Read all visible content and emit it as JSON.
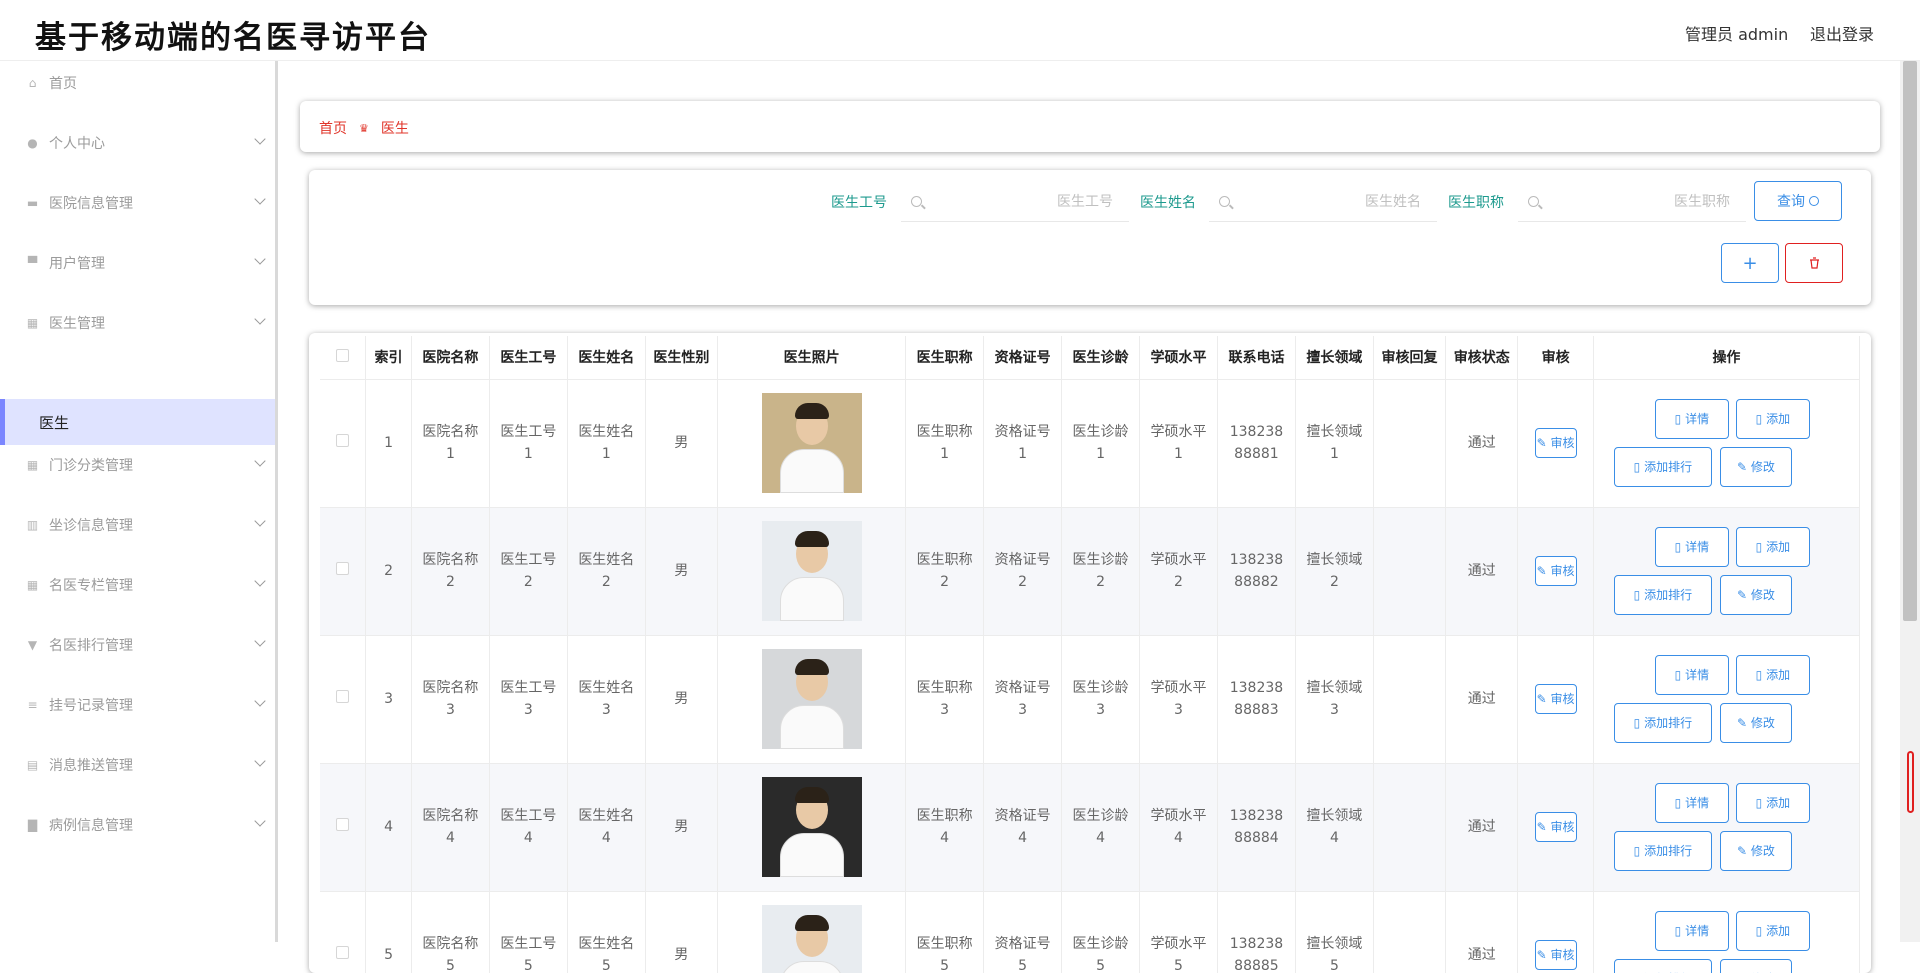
{
  "header": {
    "title": "基于移动端的名医寻访平台",
    "admin": "管理员 admin",
    "logout": "退出登录"
  },
  "sidebar": {
    "items": [
      {
        "label": "首页",
        "icon": "home-icon",
        "expandable": false
      },
      {
        "label": "个人中心",
        "icon": "user-icon",
        "expandable": true
      },
      {
        "label": "医院信息管理",
        "icon": "doc-icon",
        "expandable": true
      },
      {
        "label": "用户管理",
        "icon": "monitor-icon",
        "expandable": true
      },
      {
        "label": "医生管理",
        "icon": "grid-icon",
        "expandable": true
      },
      {
        "label": "门诊分类管理",
        "icon": "grid-icon",
        "expandable": true
      },
      {
        "label": "坐诊信息管理",
        "icon": "chart-icon",
        "expandable": true
      },
      {
        "label": "名医专栏管理",
        "icon": "grid-icon",
        "expandable": true
      },
      {
        "label": "名医排行管理",
        "icon": "trophy-icon",
        "expandable": true
      },
      {
        "label": "挂号记录管理",
        "icon": "list-icon",
        "expandable": true
      },
      {
        "label": "消息推送管理",
        "icon": "clipboard-icon",
        "expandable": true
      },
      {
        "label": "病例信息管理",
        "icon": "folder-icon",
        "expandable": true
      }
    ],
    "active_sub": "医生"
  },
  "breadcrumb": {
    "home": "首页",
    "current": "医生"
  },
  "search": {
    "fields": [
      {
        "label": "医生工号",
        "placeholder": "医生工号"
      },
      {
        "label": "医生姓名",
        "placeholder": "医生姓名"
      },
      {
        "label": "医生职称",
        "placeholder": "医生职称"
      }
    ],
    "query_label": "查询",
    "add_label": "+",
    "delete_icon": "trash-icon"
  },
  "table": {
    "columns": [
      "索引",
      "医院名称",
      "医生工号",
      "医生姓名",
      "医生性别",
      "医生照片",
      "医生职称",
      "资格证号",
      "医生诊龄",
      "学硕水平",
      "联系电话",
      "擅长领域",
      "审核回复",
      "审核状态",
      "审核",
      "操作"
    ],
    "rows": [
      {
        "index": "1",
        "hospital": "医院名称1",
        "doc_no": "医生工号1",
        "name": "医生姓名1",
        "gender": "男",
        "title": "医生职称1",
        "cert": "资格证号1",
        "years": "医生诊龄1",
        "edu": "学硕水平1",
        "phone": "13823888881",
        "field": "擅长领域1",
        "reply": "",
        "status": "通过",
        "photo_bg": "#c9b48a"
      },
      {
        "index": "2",
        "hospital": "医院名称2",
        "doc_no": "医生工号2",
        "name": "医生姓名2",
        "gender": "男",
        "title": "医生职称2",
        "cert": "资格证号2",
        "years": "医生诊龄2",
        "edu": "学硕水平2",
        "phone": "13823888882",
        "field": "擅长领域2",
        "reply": "",
        "status": "通过",
        "photo_bg": "#e8ecf0"
      },
      {
        "index": "3",
        "hospital": "医院名称3",
        "doc_no": "医生工号3",
        "name": "医生姓名3",
        "gender": "男",
        "title": "医生职称3",
        "cert": "资格证号3",
        "years": "医生诊龄3",
        "edu": "学硕水平3",
        "phone": "13823888883",
        "field": "擅长领域3",
        "reply": "",
        "status": "通过",
        "photo_bg": "#d6d8da"
      },
      {
        "index": "4",
        "hospital": "医院名称4",
        "doc_no": "医生工号4",
        "name": "医生姓名4",
        "gender": "男",
        "title": "医生职称4",
        "cert": "资格证号4",
        "years": "医生诊龄4",
        "edu": "学硕水平4",
        "phone": "13823888884",
        "field": "擅长领域4",
        "reply": "",
        "status": "通过",
        "photo_bg": "#2a2a2a"
      },
      {
        "index": "5",
        "hospital": "医院名称5",
        "doc_no": "医生工号5",
        "name": "医生姓名5",
        "gender": "男",
        "title": "医生职称5",
        "cert": "资格证号5",
        "years": "医生诊龄5",
        "edu": "学硕水平5",
        "phone": "13823888885",
        "field": "擅长领域5",
        "reply": "",
        "status": "通过",
        "photo_bg": "#e8ecf0"
      }
    ],
    "audit_label": "审核",
    "actions": {
      "detail": "详情",
      "add": "添加",
      "rank": "添加排行",
      "edit": "修改"
    }
  },
  "colors": {
    "accent": "#3a8ee6",
    "danger": "#e02020",
    "label_teal": "#1d9a8e",
    "active_bg": "#dfe3ff"
  }
}
